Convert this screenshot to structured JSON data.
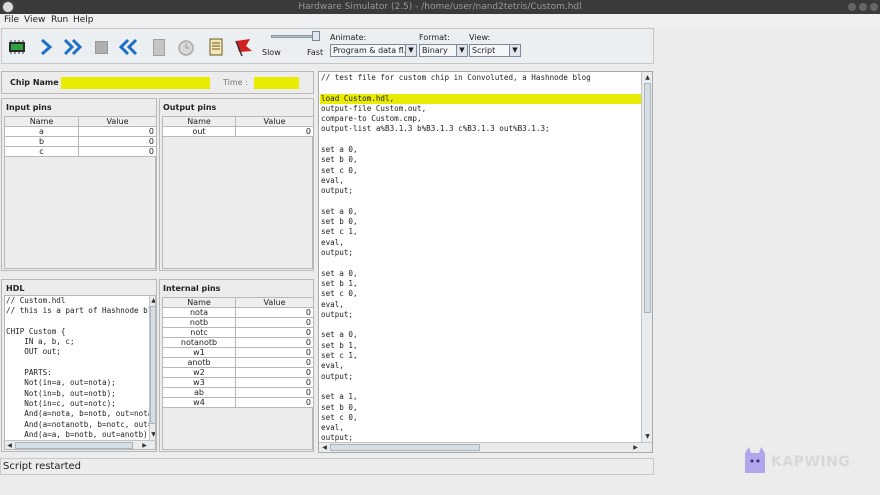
{
  "window": {
    "title": "Hardware Simulator (2.5) - /home/user/nand2tetris/Custom.hdl"
  },
  "menu": [
    "File",
    "View",
    "Run",
    "Help"
  ],
  "toolbar": {
    "slow_label": "Slow",
    "fast_label": "Fast",
    "animate_label": "Animate:",
    "animate_value": "Program & data fl...",
    "format_label": "Format:",
    "format_value": "Binary",
    "view_label": "View:",
    "view_value": "Script"
  },
  "chip": {
    "name_label": "Chip Name :",
    "name_value": "",
    "time_label": "Time :",
    "time_value": ""
  },
  "input_pins": {
    "title": "Input pins",
    "headers": [
      "Name",
      "Value"
    ],
    "rows": [
      [
        "a",
        "0"
      ],
      [
        "b",
        "0"
      ],
      [
        "c",
        "0"
      ]
    ]
  },
  "output_pins": {
    "title": "Output pins",
    "headers": [
      "Name",
      "Value"
    ],
    "rows": [
      [
        "out",
        "0"
      ]
    ]
  },
  "hdl": {
    "title": "HDL",
    "code": "// Custom.hdl\n// this is a part of Hashnode bl\n\nCHIP Custom {\n    IN a, b, c;\n    OUT out;\n\n    PARTS:\n    Not(in=a, out=nota);\n    Not(in=b, out=notb);\n    Not(in=c, out=notc);\n    And(a=nota, b=notb, out=nota\n    And(a=notanotb, b=notc, out=\n    And(a=a, b=notb, out=anotb);"
  },
  "internal_pins": {
    "title": "Internal pins",
    "headers": [
      "Name",
      "Value"
    ],
    "rows": [
      [
        "nota",
        "0"
      ],
      [
        "notb",
        "0"
      ],
      [
        "notc",
        "0"
      ],
      [
        "notanotb",
        "0"
      ],
      [
        "w1",
        "0"
      ],
      [
        "anotb",
        "0"
      ],
      [
        "w2",
        "0"
      ],
      [
        "w3",
        "0"
      ],
      [
        "ab",
        "0"
      ],
      [
        "w4",
        "0"
      ]
    ]
  },
  "script": {
    "lines": [
      "// test file for custom chip in Convoluted, a Hashnode blog",
      "",
      "load Custom.hdl,",
      "output-file Custom.out,",
      "compare-to Custom.cmp,",
      "output-list a%B3.1.3 b%B3.1.3 c%B3.1.3 out%B3.1.3;",
      "",
      "set a 0,",
      "set b 0,",
      "set c 0,",
      "eval,",
      "output;",
      "",
      "set a 0,",
      "set b 0,",
      "set c 1,",
      "eval,",
      "output;",
      "",
      "set a 0,",
      "set b 1,",
      "set c 0,",
      "eval,",
      "output;",
      "",
      "set a 0,",
      "set b 1,",
      "set c 1,",
      "eval,",
      "output;",
      "",
      "set a 1,",
      "set b 0,",
      "set c 0,",
      "eval,",
      "output;"
    ],
    "highlight_index": 2
  },
  "status": {
    "message": "Script restarted"
  },
  "watermark": {
    "text": "KAPWING"
  },
  "colors": {
    "highlight": "#e9ec00",
    "chip_field": "#e9ec00"
  }
}
